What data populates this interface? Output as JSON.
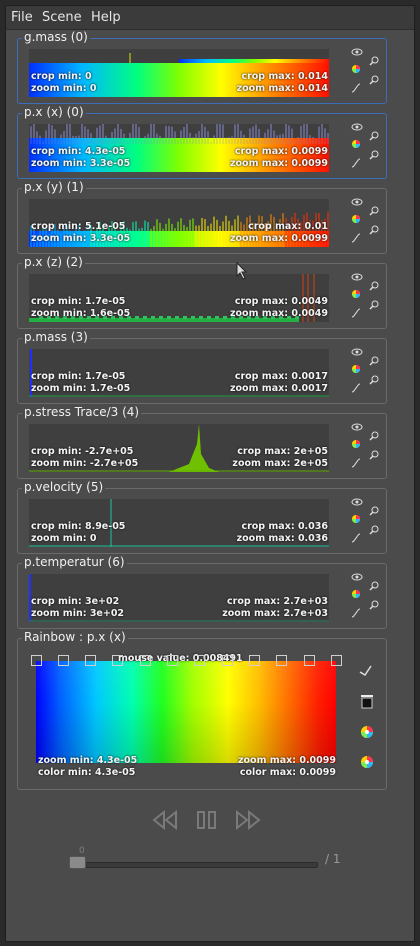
{
  "menu": {
    "file": "File",
    "scene": "Scene",
    "help": "Help"
  },
  "panels": [
    {
      "title": "g.mass (0)",
      "crop_min": "crop min: 0",
      "crop_max": "crop max: 0.014",
      "zoom_min": "zoom min: 0",
      "zoom_max": "zoom max: 0.014"
    },
    {
      "title": "p.x (x) (0)",
      "crop_min": "crop min: 4.3e-05",
      "crop_max": "crop max: 0.0099",
      "zoom_min": "zoom min: 3.3e-05",
      "zoom_max": "zoom max: 0.0099"
    },
    {
      "title": "p.x (y) (1)",
      "crop_min": "crop min: 5.1e-05",
      "crop_max": "crop max: 0.01",
      "zoom_min": "zoom min: 3.3e-05",
      "zoom_max": "zoom max: 0.0099"
    },
    {
      "title": "p.x (z) (2)",
      "crop_min": "crop min: 1.7e-05",
      "crop_max": "crop max: 0.0049",
      "zoom_min": "zoom min: 1.6e-05",
      "zoom_max": "zoom max: 0.0049"
    },
    {
      "title": "p.mass (3)",
      "crop_min": "crop min: 1.7e-05",
      "crop_max": "crop max: 0.0017",
      "zoom_min": "zoom min: 1.7e-05",
      "zoom_max": "zoom max: 0.0017"
    },
    {
      "title": "p.stress Trace/3 (4)",
      "crop_min": "crop min: -2.7e+05",
      "crop_max": "crop max: 2e+05",
      "zoom_min": "zoom min: -2.7e+05",
      "zoom_max": "zoom max: 2e+05"
    },
    {
      "title": "p.velocity (5)",
      "crop_min": "crop min: 8.9e-05",
      "crop_max": "crop max: 0.036",
      "zoom_min": "zoom min: 0",
      "zoom_max": "zoom max: 0.036"
    },
    {
      "title": "p.temperatur (6)",
      "crop_min": "crop min: 3e+02",
      "crop_max": "crop max: 2.7e+03",
      "zoom_min": "zoom min: 3e+02",
      "zoom_max": "zoom max: 2.7e+03"
    }
  ],
  "colormap": {
    "title": "Rainbow : p.x (x)",
    "mouse_value": "mouse value: 0.008491",
    "zoom_min": "zoom min: 4.3e-05",
    "zoom_max": "zoom max: 0.0099",
    "color_min": "color min: 4.3e-05",
    "color_max": "color max: 0.0099"
  },
  "playback": {
    "frame_total": "/ 1",
    "frame_current": "0"
  },
  "colors": {
    "selected_border": "#3c6db6",
    "panel_border": "#6a6a6a",
    "window_bg": "#4b4b4b"
  }
}
